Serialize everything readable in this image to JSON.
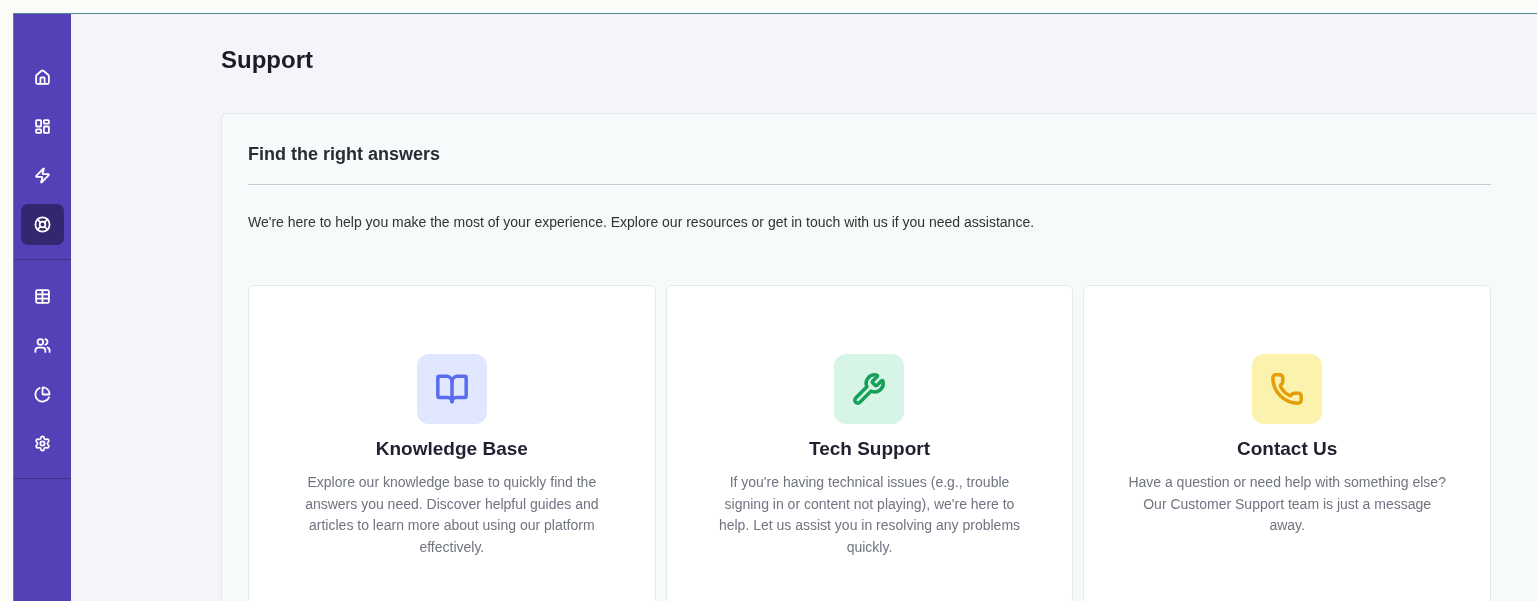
{
  "sidebar": {
    "groups": [
      {
        "items": [
          {
            "kind": "home",
            "selected": false
          },
          {
            "kind": "dashboard",
            "selected": false
          },
          {
            "kind": "bolt",
            "selected": false
          },
          {
            "kind": "lifebuoy",
            "selected": true
          }
        ]
      },
      {
        "items": [
          {
            "kind": "table",
            "selected": false
          },
          {
            "kind": "users",
            "selected": false
          },
          {
            "kind": "pie",
            "selected": false
          },
          {
            "kind": "settings",
            "selected": false
          }
        ]
      }
    ]
  },
  "page": {
    "title": "Support"
  },
  "panel": {
    "title": "Find the right answers",
    "intro": "We're here to help you make the most of your experience. Explore our resources or get in touch with us if you need assistance.",
    "cards": [
      {
        "kind": "book",
        "title": "Knowledge Base",
        "text": "Explore our knowledge base to quickly find the answers you need. Discover helpful guides and articles to learn more about using our platform effectively."
      },
      {
        "kind": "tools",
        "title": "Tech Support",
        "text": "If you're having technical issues (e.g., trouble signing in or content not playing), we're here to help. Let us assist you in resolving any problems quickly."
      },
      {
        "kind": "phone",
        "title": "Contact Us",
        "text": "Have a question or need help with something else? Our Customer Support team is just a message away."
      }
    ]
  }
}
